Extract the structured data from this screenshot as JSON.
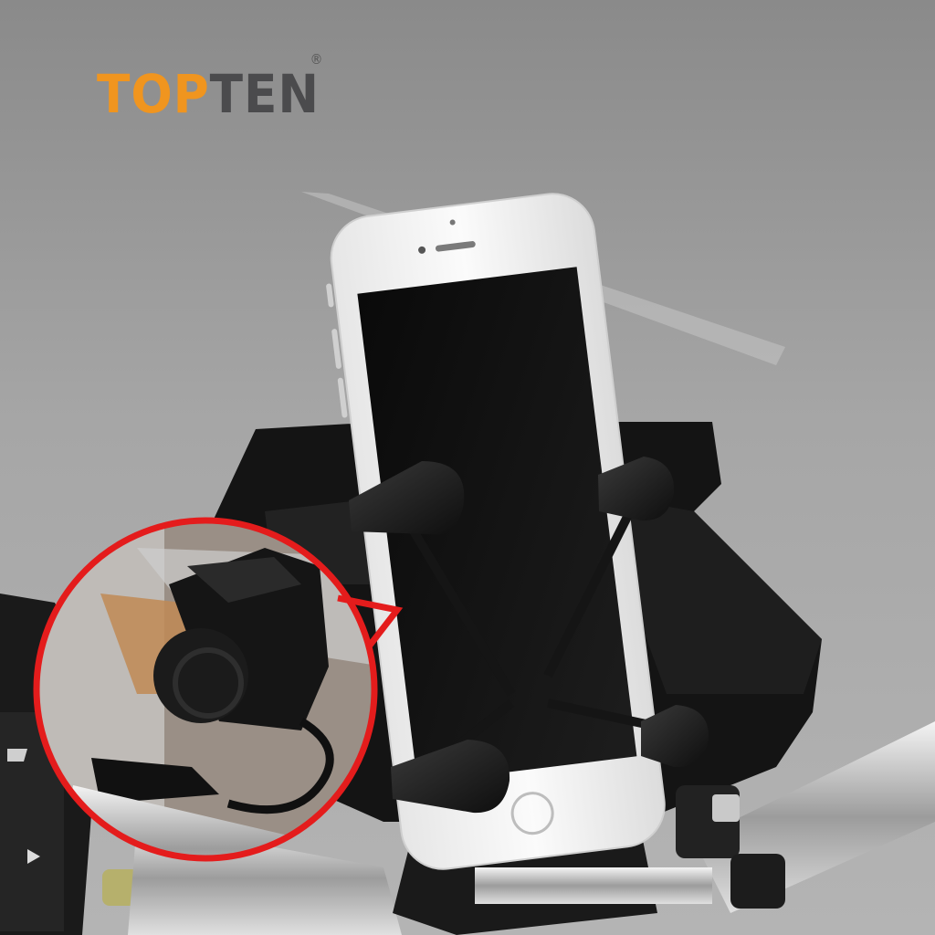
{
  "logo": {
    "part1": "TOP",
    "part2": "TEN",
    "mark": "®",
    "colors": {
      "part1": "#f0951f",
      "part2": "#4b4b4d"
    }
  },
  "scene": {
    "subject": "smartphone-in-x-grip-handlebar-mount",
    "callout_color": "#e41c1c"
  }
}
